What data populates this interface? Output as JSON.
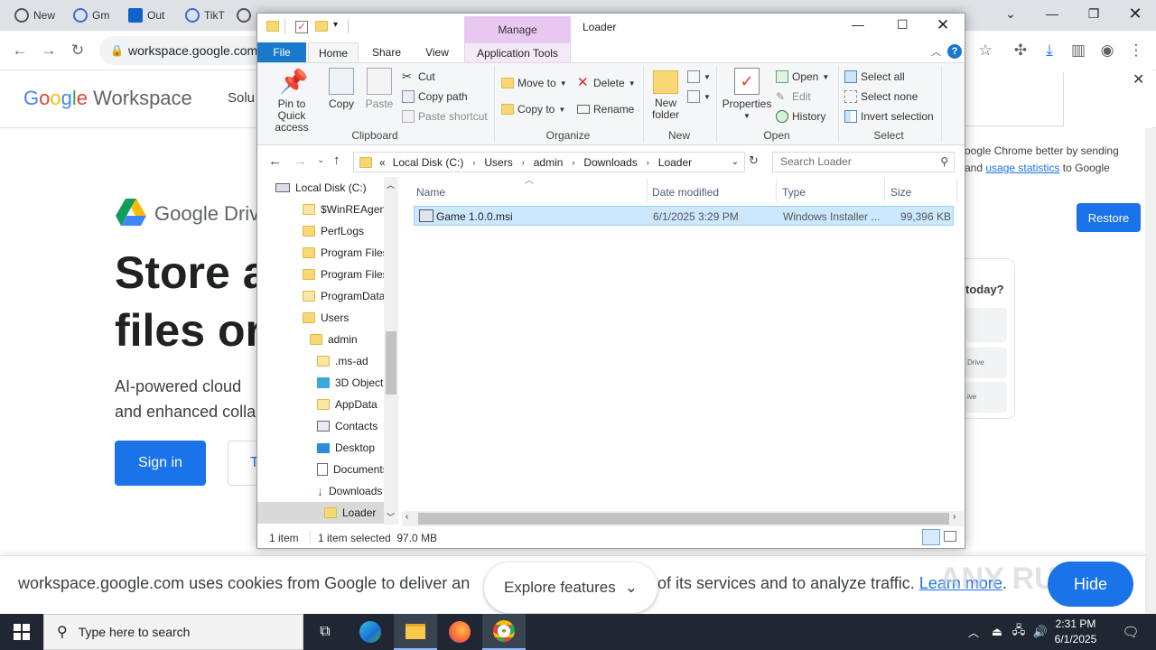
{
  "chrome": {
    "tabs": [
      "New",
      "Gm",
      "Out",
      "TikT"
    ],
    "url": "workspace.google.com/",
    "page": {
      "logo": "Google Workspace",
      "nav_partial": "Solu",
      "drive_label": "Google Driv",
      "headline_line1": "Store a",
      "headline_line2": "files or",
      "subtext_line1": "AI-powered cloud",
      "subtext_line2": "and enhanced colla",
      "signin_label": "Sign in",
      "try_label": "T"
    },
    "notification": {
      "text_line1": "oogle Chrome better by sending",
      "text_line2_pre": "and",
      "link": "usage statistics",
      "text_line2_post": "to Google",
      "restore_label": "Restore",
      "today_label": "today?",
      "drive_small": "Drive",
      "ive_small": "ive"
    },
    "cookie": {
      "text_left": "workspace.google.com uses cookies from Google to deliver an",
      "text_right": "of its services and to analyze traffic.",
      "learn_more": "Learn more",
      "explore_label": "Explore features",
      "hide_label": "Hide",
      "watermark": "ANY RUN"
    }
  },
  "explorer": {
    "window_title": "Loader",
    "manage_label": "Manage",
    "tabs": {
      "file": "File",
      "home": "Home",
      "share": "Share",
      "view": "View",
      "app_tools": "Application Tools"
    },
    "ribbon": {
      "clipboard": {
        "label": "Clipboard",
        "pin": "Pin to Quick access",
        "copy": "Copy",
        "paste": "Paste",
        "cut": "Cut",
        "copy_path": "Copy path",
        "paste_shortcut": "Paste shortcut"
      },
      "organize": {
        "label": "Organize",
        "move_to": "Move to",
        "copy_to": "Copy to",
        "delete": "Delete",
        "rename": "Rename"
      },
      "new": {
        "label": "New",
        "new_folder": "New folder"
      },
      "open": {
        "label": "Open",
        "properties": "Properties",
        "open": "Open",
        "edit": "Edit",
        "history": "History"
      },
      "select": {
        "label": "Select",
        "select_all": "Select all",
        "select_none": "Select none",
        "invert": "Invert selection"
      }
    },
    "address": {
      "crumbs": [
        "«",
        "Local Disk (C:)",
        "Users",
        "admin",
        "Downloads",
        "Loader"
      ],
      "search_placeholder": "Search Loader"
    },
    "nav_items": [
      "Local Disk (C:)",
      "$WinREAgent",
      "PerfLogs",
      "Program Files",
      "Program Files",
      "ProgramData",
      "Users",
      "admin",
      ".ms-ad",
      "3D Objects",
      "AppData",
      "Contacts",
      "Desktop",
      "Documents",
      "Downloads",
      "Loader"
    ],
    "columns": {
      "name": "Name",
      "date": "Date modified",
      "type": "Type",
      "size": "Size"
    },
    "files": [
      {
        "name": "Game 1.0.0.msi",
        "date": "6/1/2025 3:29 PM",
        "type": "Windows Installer ...",
        "size": "99,396 KB"
      }
    ],
    "status": {
      "count": "1 item",
      "selected": "1 item selected  97.0 MB"
    }
  },
  "taskbar": {
    "search_placeholder": "Type here to search",
    "time": "2:31 PM",
    "date": "6/1/2025"
  }
}
